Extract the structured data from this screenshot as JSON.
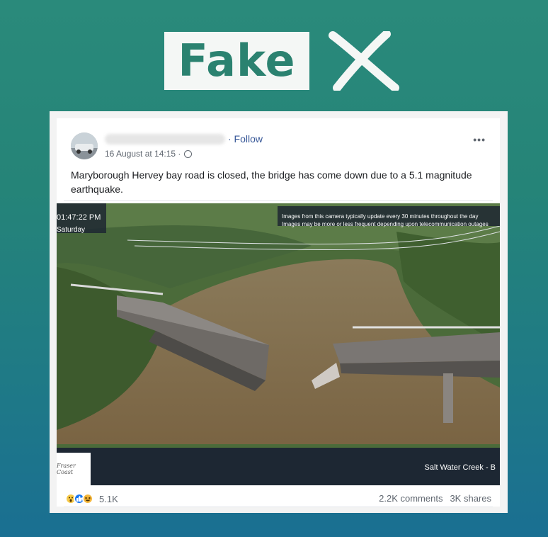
{
  "banner": {
    "label": "Fake"
  },
  "post": {
    "follow_label": "· Follow",
    "timestamp": "16 August at 14:15 ·",
    "more_label": "•••",
    "caption": "Maryborough Hervey bay road is closed, the bridge has come down due to a 5.1 magnitude earthquake.",
    "image": {
      "time": "01:47:22 PM",
      "day": "Saturday",
      "note_line1": "Images from this camera typically update every 30 minutes throughout the day",
      "note_line2": "Images may be more or less frequent depending upon telecommunication outages",
      "logo": "Fraser Coast",
      "location": "Salt Water Creek - B"
    },
    "reactions": {
      "icons": [
        "wow",
        "like",
        "haha"
      ],
      "count": "5.1K"
    },
    "comments": "2.2K comments",
    "shares": "3K shares"
  },
  "colors": {
    "banner_text": "#2b8270",
    "follow": "#385898",
    "bg_top": "#2a8a7b",
    "bg_bottom": "#1a6f92"
  }
}
